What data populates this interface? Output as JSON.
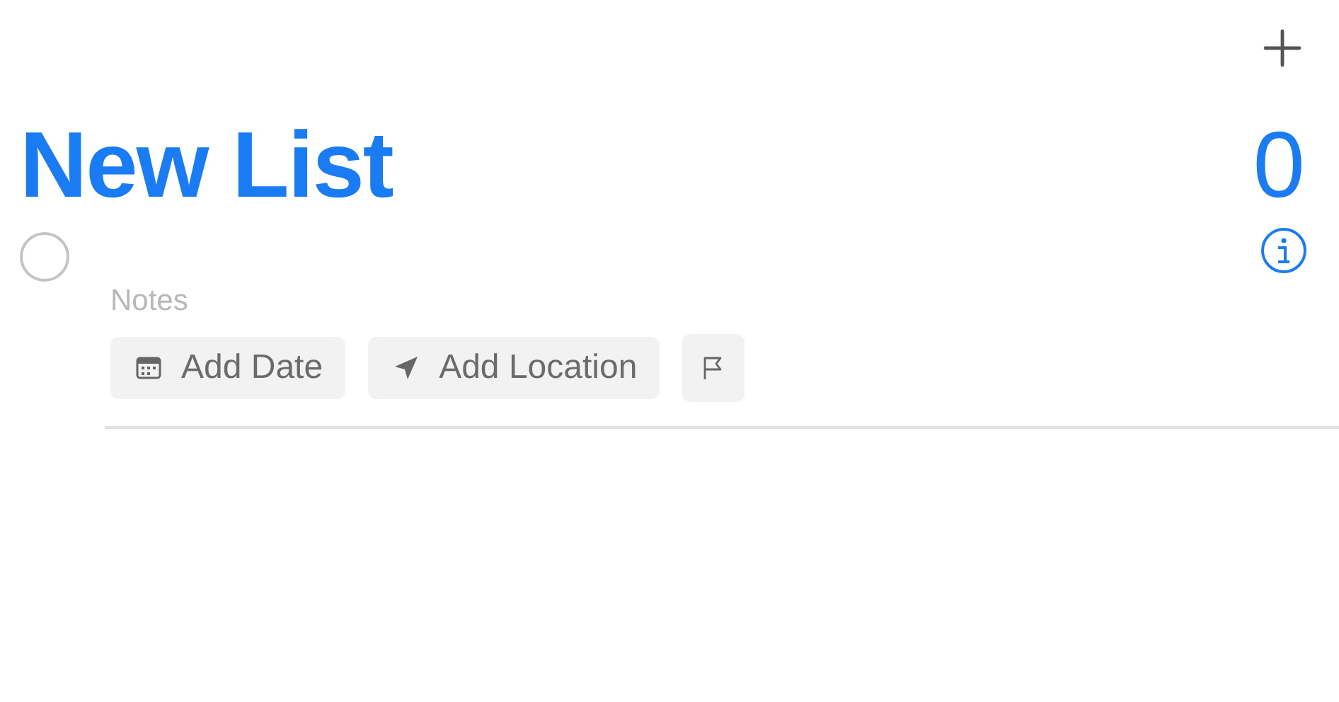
{
  "list": {
    "title": "New List",
    "count": "0"
  },
  "reminder": {
    "checked": false,
    "notes": {
      "placeholder": "Notes"
    },
    "actions": [
      {
        "kind": "date",
        "label": "Add Date"
      },
      {
        "kind": "location",
        "label": "Add Location"
      },
      {
        "kind": "flag"
      }
    ]
  }
}
